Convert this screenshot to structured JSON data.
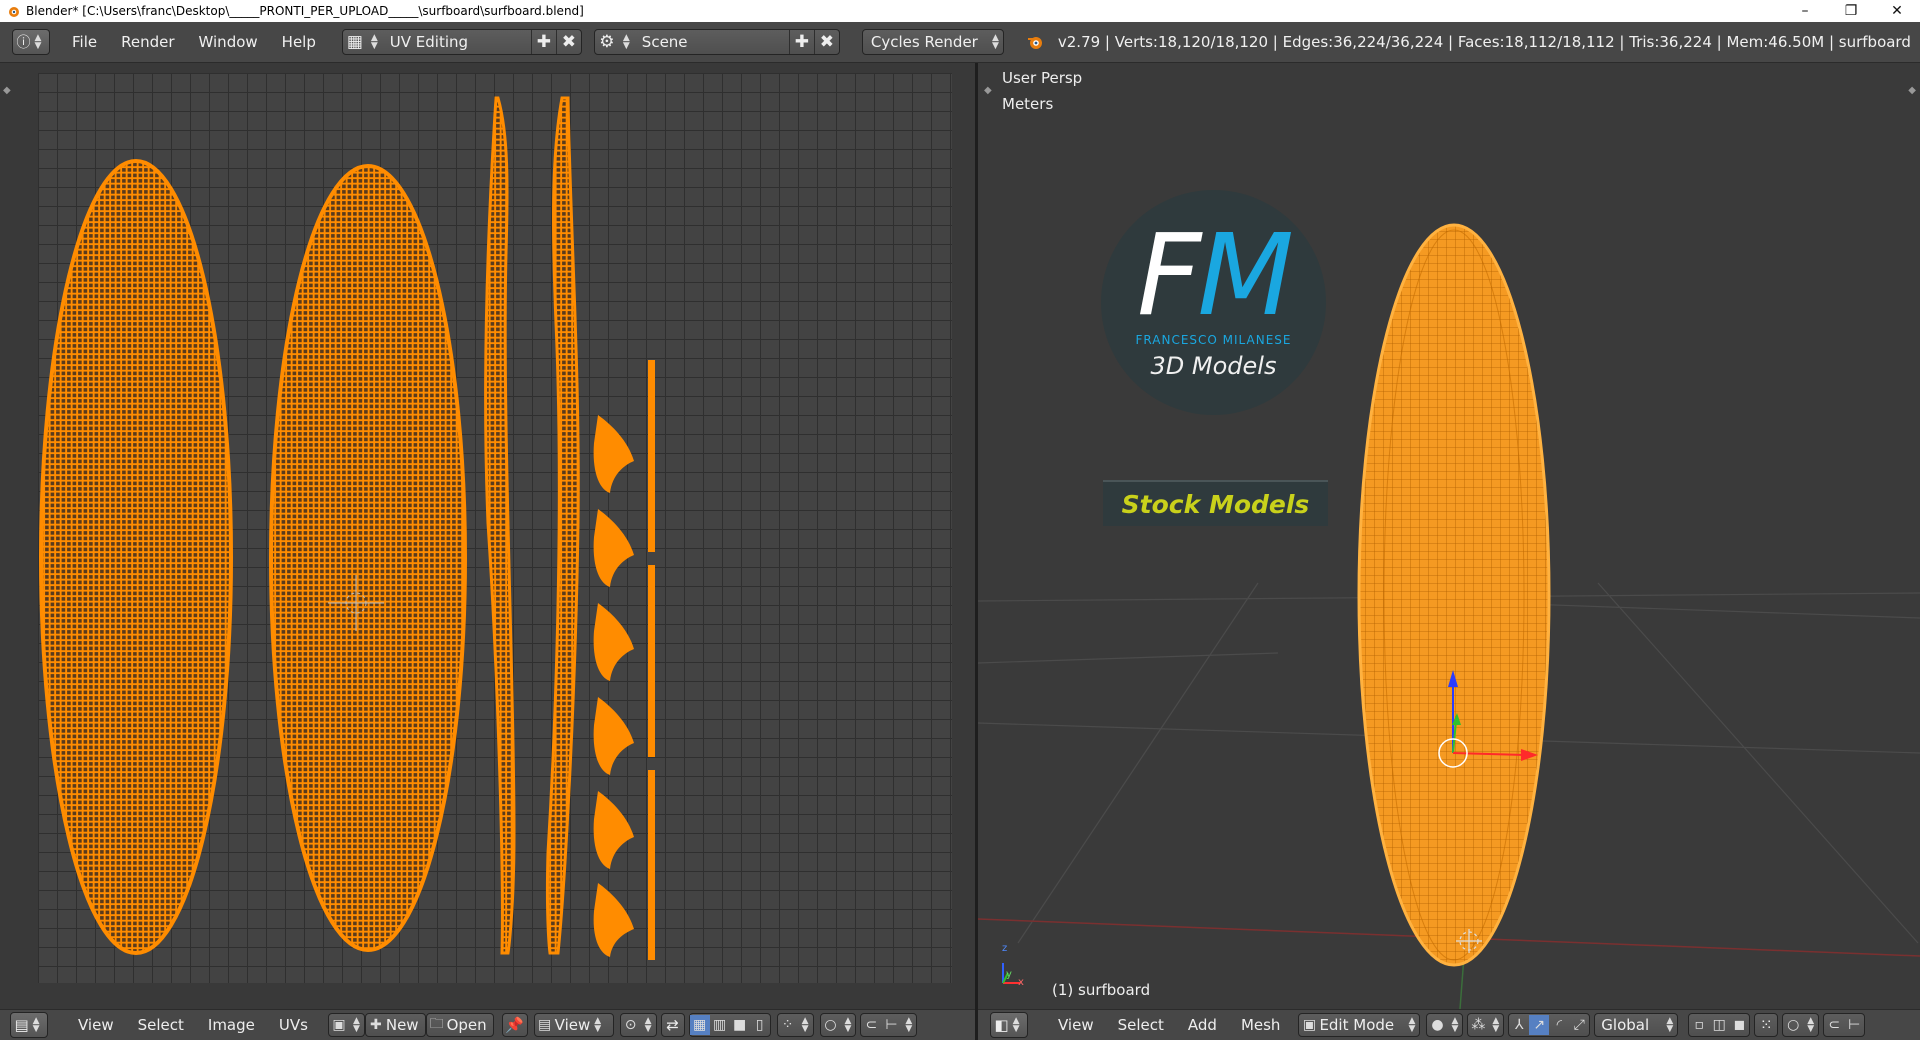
{
  "window": {
    "title": "Blender* [C:\\Users\\franc\\Desktop\\_____PRONTI_PER_UPLOAD_____\\surfboard\\surfboard.blend]",
    "minimize": "–",
    "maximize": "❐",
    "close": "✕"
  },
  "infobar": {
    "menus": [
      "File",
      "Render",
      "Window",
      "Help"
    ],
    "layout": "UV Editing",
    "scene": "Scene",
    "engine": "Cycles Render",
    "stats": "v2.79 | Verts:18,120/18,120 | Edges:36,224/36,224 | Faces:18,112/18,112 | Tris:36,224 | Mem:46.50M | surfboard"
  },
  "viewport": {
    "view_name": "User Persp",
    "units": "Meters",
    "object_label": "(1) surfboard",
    "axis_x": "x",
    "axis_y": "y",
    "axis_z": "z"
  },
  "logo": {
    "f": "F",
    "m": "M",
    "name": "FRANCESCO MILANESE",
    "subtitle": "3D Models",
    "stock": "Stock Models"
  },
  "uv_footer": {
    "menus": [
      "View",
      "Select",
      "Image",
      "UVs"
    ],
    "new_label": "New",
    "open_label": "Open",
    "view_label": "View"
  },
  "vp_footer": {
    "menus": [
      "View",
      "Select",
      "Add",
      "Mesh"
    ],
    "mode": "Edit Mode",
    "orientation": "Global"
  },
  "colors": {
    "uv_mesh": "#ff8c00",
    "board": "#f49a1e",
    "wire": "#b86400"
  }
}
